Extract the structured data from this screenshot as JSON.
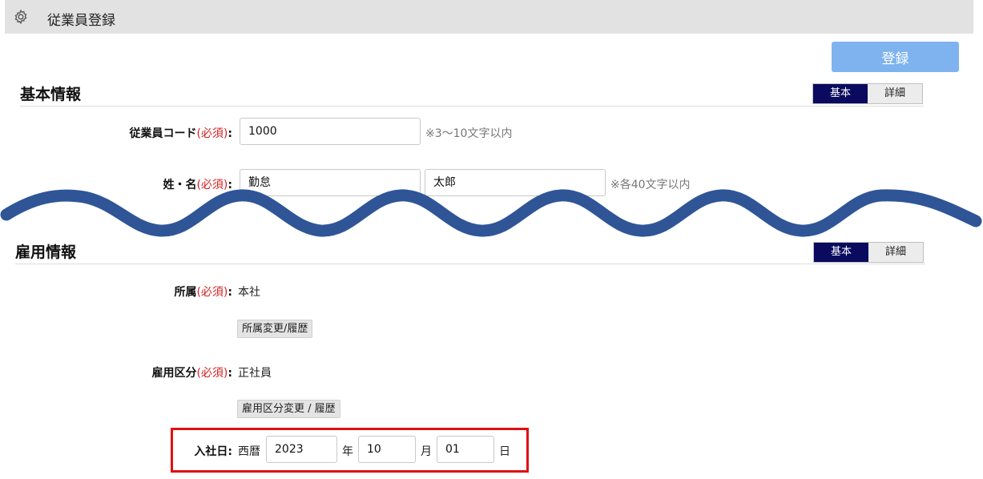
{
  "header": {
    "title": "従業員登録",
    "icon": "gear-icon"
  },
  "actions": {
    "register_label": "登録"
  },
  "basic_section": {
    "title": "基本情報",
    "toggle": {
      "basic": "基本",
      "detail": "詳細"
    },
    "employee_code": {
      "label": "従業員コード",
      "required": "(必須)",
      "colon": ":",
      "value": "1000",
      "hint": "※3〜10文字以内"
    },
    "name": {
      "label": "姓・名",
      "required": "(必須)",
      "colon": ":",
      "last_name": "勤怠",
      "first_name": "太郎",
      "hint": "※各40文字以内"
    }
  },
  "employment_section": {
    "title": "雇用情報",
    "toggle": {
      "basic": "基本",
      "detail": "詳細"
    },
    "department": {
      "label": "所属",
      "required": "(必須)",
      "colon": ":",
      "value": "本社",
      "button": "所属変更/履歴"
    },
    "employment_type": {
      "label": "雇用区分",
      "required": "(必須)",
      "colon": ":",
      "value": "正社員",
      "button": "雇用区分変更 / 履歴"
    },
    "hire_date": {
      "label": "入社日",
      "colon": ":",
      "era": "西暦",
      "year": "2023",
      "year_unit": "年",
      "month": "10",
      "month_unit": "月",
      "day": "01",
      "day_unit": "日"
    }
  },
  "colors": {
    "accent_button": "#7eb3ef",
    "toggle_active": "#0a0a5f",
    "required_text": "#d32020",
    "highlight_border": "#e01010",
    "wave": "#2f5597"
  }
}
